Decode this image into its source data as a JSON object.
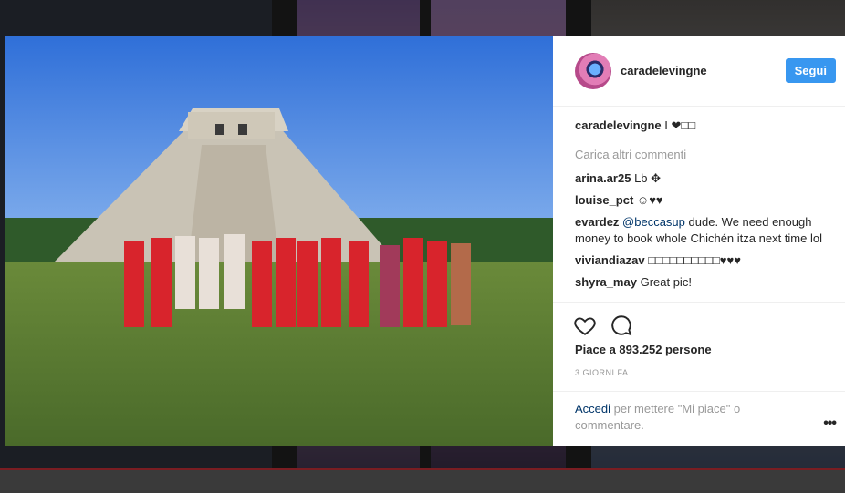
{
  "post": {
    "username": "caradelevingne",
    "follow_label": "Segui",
    "caption_user": "caradelevingne",
    "caption_text": "I ❤□□",
    "load_more": "Carica altri commenti",
    "comments": [
      {
        "user": "arina.ar25",
        "text": "Lb ✥"
      },
      {
        "user": "louise_pct",
        "text": "☺♥♥"
      },
      {
        "user": "evardez",
        "mention": "@beccasup",
        "text": " dude. We need enough money to book whole Chichén itza next time lol"
      },
      {
        "user": "viviandiazav",
        "text": "□□□□□□□□□□♥♥♥"
      },
      {
        "user": "shyra_may",
        "text": "Great pic!"
      }
    ],
    "likes": "Piace a 893.252 persone",
    "time": "3 GIORNI FA",
    "login_link": "Accedi",
    "login_text": " per mettere \"Mi piace\" o commentare.",
    "more": "•••"
  },
  "icons": [
    "heart-icon",
    "comment-icon",
    "more-icon"
  ],
  "colors": {
    "accent": "#3897f0",
    "link": "#003569",
    "muted": "#999999",
    "text": "#262626"
  }
}
